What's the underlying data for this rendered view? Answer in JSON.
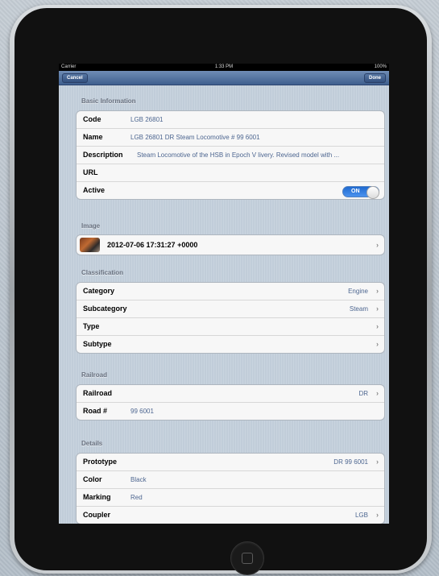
{
  "status_bar": {
    "carrier": "Carrier",
    "time": "1:33 PM",
    "battery": "100%"
  },
  "nav": {
    "cancel": "Cancel",
    "done": "Done"
  },
  "sections": {
    "basic": "Basic Information",
    "image": "Image",
    "classification": "Classification",
    "railroad": "Railroad",
    "details": "Details"
  },
  "basic": {
    "code_label": "Code",
    "code_value": "LGB 26801",
    "name_label": "Name",
    "name_value": "LGB 26801 DR Steam Locomotive # 99 6001",
    "description_label": "Description",
    "description_value": "Steam Locomotive of the HSB in Epoch V livery.  Revised model with ...",
    "url_label": "URL",
    "active_label": "Active",
    "active_toggle": "ON"
  },
  "image": {
    "timestamp": "2012-07-06 17:31:27 +0000"
  },
  "classification": {
    "category_label": "Category",
    "category_value": "Engine",
    "subcategory_label": "Subcategory",
    "subcategory_value": "Steam",
    "type_label": "Type",
    "subtype_label": "Subtype"
  },
  "railroad": {
    "railroad_label": "Railroad",
    "railroad_value": "DR",
    "road_label": "Road #",
    "road_value": "99 6001"
  },
  "details": {
    "prototype_label": "Prototype",
    "prototype_value": "DR 99 6001",
    "color_label": "Color",
    "color_value": "Black",
    "marking_label": "Marking",
    "marking_value": "Red",
    "coupler_label": "Coupler",
    "coupler_value": "LGB"
  },
  "chevron": "›"
}
